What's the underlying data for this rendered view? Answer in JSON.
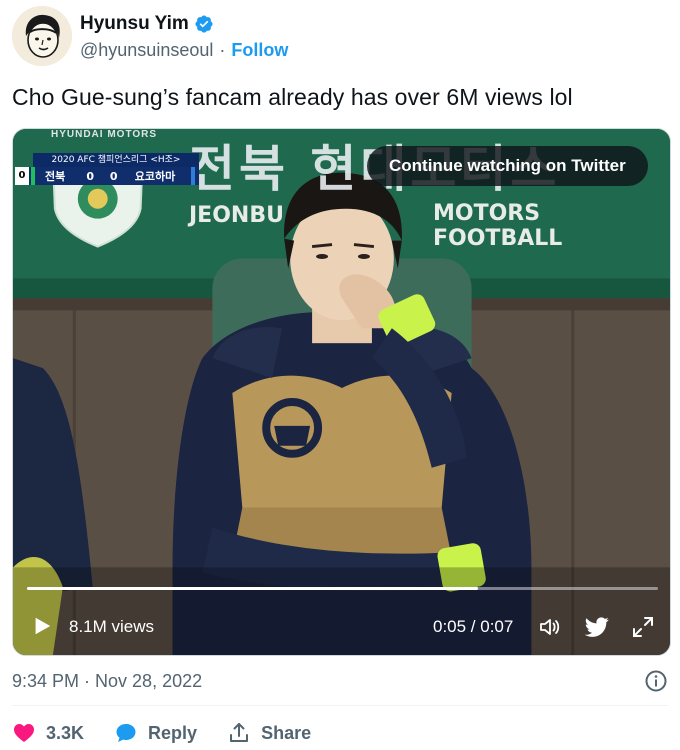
{
  "user": {
    "display_name": "Hyunsu Yim",
    "handle": "@hyunsuinseoul",
    "separator": "·",
    "follow_label": "Follow"
  },
  "tweet": {
    "text": "Cho Gue-sung’s fancam already has over 6M views lol"
  },
  "video": {
    "continue_label": "Continue watching on Twitter",
    "views": "8.1M views",
    "time": "0:05 / 0:07",
    "progress": 0.714,
    "scoreboard": {
      "title": "2020 AFC 챔피언스리그 <H조>",
      "left_score": "0",
      "team1": "전북",
      "score": "0 0",
      "team2": "요코하마"
    },
    "banner": {
      "korean": "전북 현대모터스",
      "english_left": "JEONBU",
      "english_right": "MOTORS FOOTBALL",
      "hyundai": "HYUNDAI MOTORS"
    }
  },
  "footer": {
    "timestamp": "9:34 PM · Nov 28, 2022",
    "like_count": "3.3K",
    "reply_label": "Reply",
    "share_label": "Share"
  },
  "colors": {
    "accent": "#1d9bf0",
    "like": "#f91880",
    "text": "#0f1419",
    "secondary": "#536471"
  }
}
